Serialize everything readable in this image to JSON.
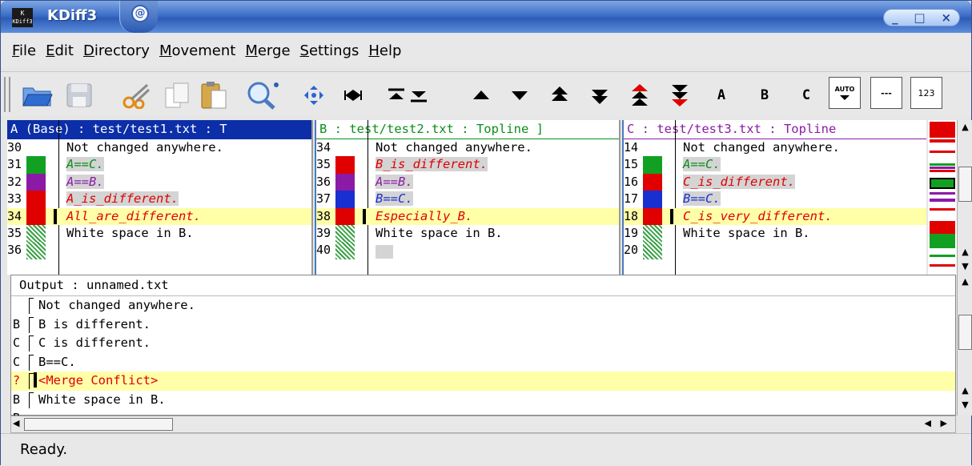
{
  "window": {
    "title": "KDiff3",
    "app_icon_text": "KDiff3",
    "buttons": [
      "_",
      "□",
      "×"
    ]
  },
  "menu": [
    "File",
    "Edit",
    "Directory",
    "Movement",
    "Merge",
    "Settings",
    "Help"
  ],
  "toolbar": {
    "icons": [
      "open-folder",
      "save",
      "cut",
      "copy",
      "paste",
      "find",
      "goto-current-delta",
      "goto-top",
      "goto-prev-delta",
      "goto-next-delta",
      "goto-prev-conflict",
      "goto-next-conflict",
      "goto-bottom",
      "goto-prev-unsolved-conflict",
      "goto-next-unsolved-conflict"
    ],
    "a_label": "A",
    "b_label": "B",
    "c_label": "C",
    "auto_label": "AUTO",
    "dash_label": "---",
    "num_label": "123"
  },
  "panes": {
    "a": {
      "header": "A (Base) : test/test1.txt : T",
      "header_bg": "#0c2ea8",
      "rows": [
        {
          "num": "30",
          "text": "Not changed anywhere."
        },
        {
          "num": "31",
          "text": "A==C."
        },
        {
          "num": "32",
          "text": "A==B."
        },
        {
          "num": "33",
          "text": "A_is_different."
        },
        {
          "num": "34",
          "text": "All_are_different."
        },
        {
          "num": "35",
          "text": "White space in B."
        },
        {
          "num": "36",
          "text": ""
        }
      ]
    },
    "b": {
      "header": "B : test/test2.txt : Topline ]",
      "header_color": "#0a8f1a",
      "rows": [
        {
          "num": "34",
          "text": "Not changed anywhere."
        },
        {
          "num": "35",
          "text": "B_is_different."
        },
        {
          "num": "36",
          "text": "A==B."
        },
        {
          "num": "37",
          "text": "B==C."
        },
        {
          "num": "38",
          "text": "Especially_B."
        },
        {
          "num": "39",
          "text": "White  space  in B."
        },
        {
          "num": "40",
          "text": ""
        }
      ]
    },
    "c": {
      "header": "C : test/test3.txt : Topline",
      "header_color": "#8b1ba6",
      "rows": [
        {
          "num": "14",
          "text": "Not changed anywhere."
        },
        {
          "num": "15",
          "text": "A==C."
        },
        {
          "num": "16",
          "text": "C_is_different."
        },
        {
          "num": "17",
          "text": "B==C."
        },
        {
          "num": "18",
          "text": "C_is_very_different."
        },
        {
          "num": "19",
          "text": "White space in B."
        },
        {
          "num": "20",
          "text": ""
        }
      ]
    }
  },
  "output": {
    "header": "Output : unnamed.txt",
    "rows": [
      {
        "src": "",
        "text": "Not changed anywhere."
      },
      {
        "src": "B",
        "text": "B is different."
      },
      {
        "src": "C",
        "text": "C is different."
      },
      {
        "src": "C",
        "text": "B==C."
      },
      {
        "src": "?",
        "text": "<Merge Conflict>"
      },
      {
        "src": "B",
        "text": "White  space  in B."
      },
      {
        "src": "B",
        "text": ""
      }
    ]
  },
  "status": "Ready."
}
